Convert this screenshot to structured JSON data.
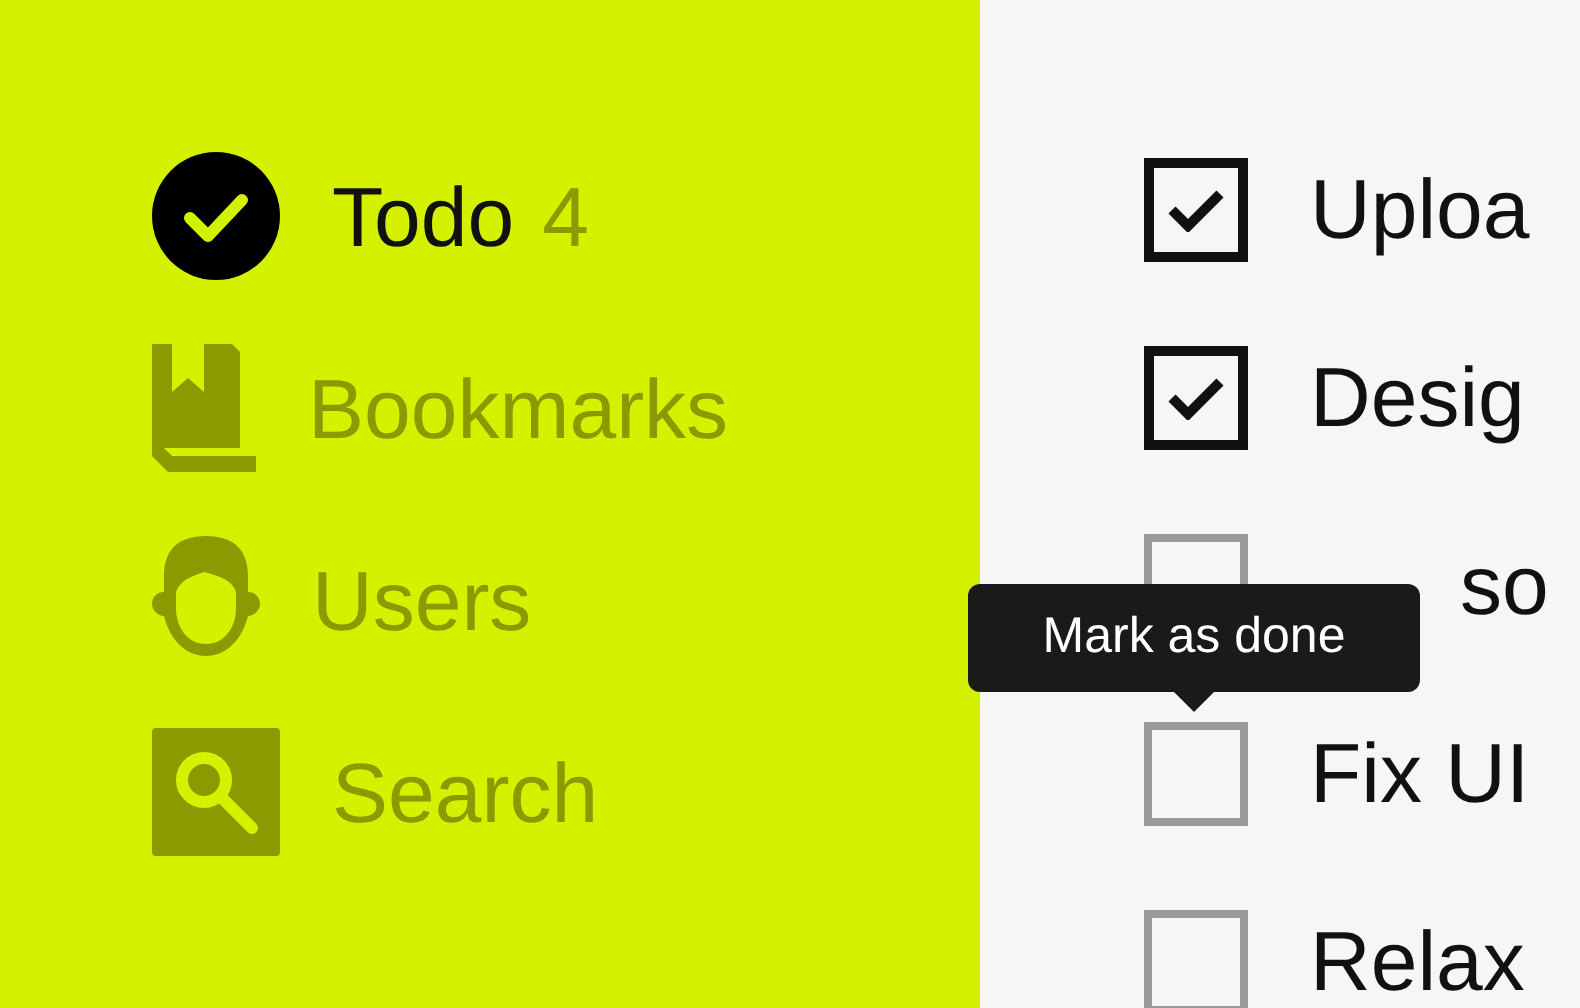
{
  "sidebar": {
    "items": [
      {
        "kind": "check",
        "label": "Todo",
        "count": "4",
        "selected": true
      },
      {
        "kind": "book",
        "label": "Bookmarks",
        "selected": false
      },
      {
        "kind": "user",
        "label": "Users",
        "selected": false
      },
      {
        "kind": "search",
        "label": "Search",
        "selected": false
      }
    ]
  },
  "tasks": [
    {
      "text": "Uploa",
      "checked": true,
      "covered_start": false
    },
    {
      "text": "Desig",
      "checked": true,
      "covered_start": false
    },
    {
      "text": "so",
      "checked": false,
      "covered_start": true
    },
    {
      "text": "Fix UI",
      "checked": false,
      "covered_start": false
    },
    {
      "text": "Relax",
      "checked": false,
      "covered_start": false
    }
  ],
  "tooltip": {
    "text": "Mark as done"
  }
}
